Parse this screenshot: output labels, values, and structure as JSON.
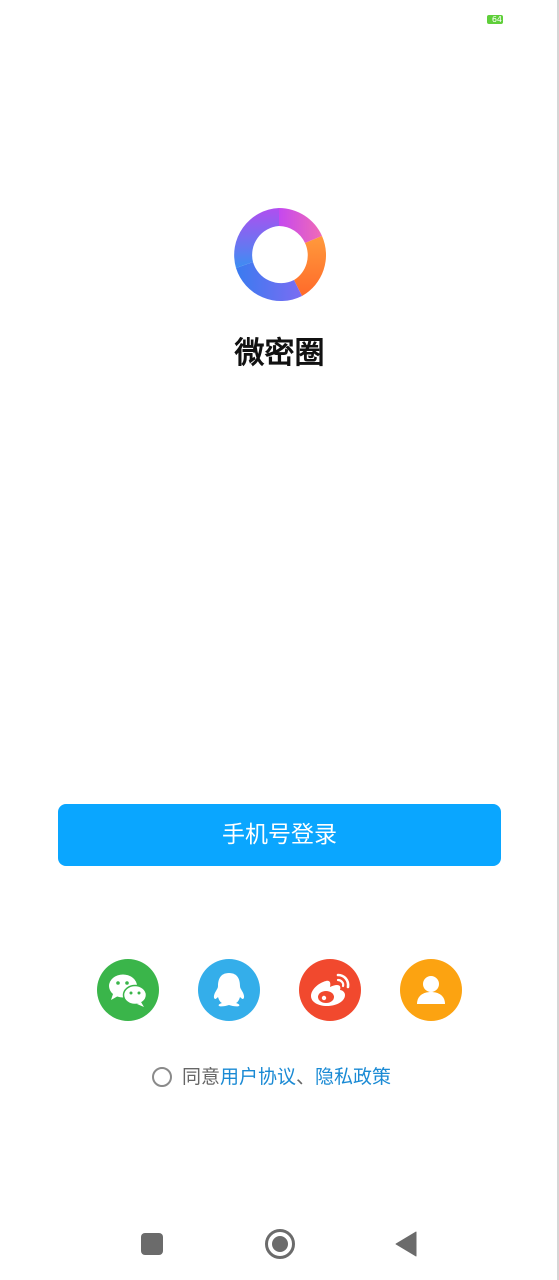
{
  "status_bar": {
    "battery_level": "64",
    "battery_color": "#5fcf3a"
  },
  "app": {
    "name": "微密圈",
    "logo_icon": "ring-logo-icon"
  },
  "login": {
    "phone_login_label": "手机号登录",
    "button_color": "#0aa6ff"
  },
  "social_logins": [
    {
      "id": "wechat",
      "icon": "wechat-icon",
      "color": "#3ab54a"
    },
    {
      "id": "qq",
      "icon": "qq-penguin-icon",
      "color": "#34aeea"
    },
    {
      "id": "weibo",
      "icon": "weibo-icon",
      "color": "#f1492e"
    },
    {
      "id": "guest",
      "icon": "person-icon",
      "color": "#fca311"
    }
  ],
  "agreement": {
    "checked": false,
    "agree_text": "同意",
    "user_agreement": "用户协议",
    "separator": "、",
    "privacy_policy": "隐私政策",
    "link_color": "#1a8ad4"
  },
  "nav_bar": {
    "recent_icon": "square-icon",
    "home_icon": "circle-home-icon",
    "back_icon": "triangle-back-icon"
  }
}
